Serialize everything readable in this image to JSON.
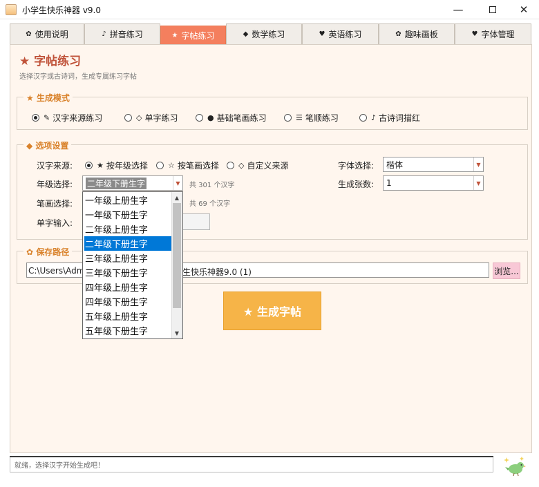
{
  "window": {
    "title": "小学生快乐神器 v9.0",
    "minimize_glyph": "—",
    "close_glyph": "✕"
  },
  "tabs": [
    {
      "icon": "✿",
      "label": "使用说明"
    },
    {
      "icon": "♪",
      "label": "拼音练习"
    },
    {
      "icon": "★",
      "label": "字帖练习",
      "active": true
    },
    {
      "icon": "◆",
      "label": "数学练习"
    },
    {
      "icon": "♥",
      "label": "英语练习"
    },
    {
      "icon": "✿",
      "label": "趣味画板"
    },
    {
      "icon": "♥",
      "label": "字体管理"
    }
  ],
  "page": {
    "title": "★ 字帖练习",
    "subtitle": "选择汉字或古诗词，生成专属练习字帖"
  },
  "mode": {
    "legend": "★ 生成模式",
    "options": [
      {
        "glyph": "✎",
        "label": "汉字来源练习",
        "checked": true
      },
      {
        "glyph": "◇",
        "label": "单字练习",
        "checked": false
      },
      {
        "glyph": "●",
        "label": "基础笔画练习",
        "checked": false
      },
      {
        "glyph": "☰",
        "label": "笔顺练习",
        "checked": false
      },
      {
        "glyph": "♪",
        "label": "古诗词描红",
        "checked": false
      }
    ]
  },
  "options": {
    "legend": "◆ 选项设置",
    "source_label": "汉字来源:",
    "source_options": [
      {
        "glyph": "★",
        "label": "按年级选择",
        "checked": true
      },
      {
        "glyph": "☆",
        "label": "按笔画选择",
        "checked": false
      },
      {
        "glyph": "◇",
        "label": "自定义来源",
        "checked": false
      }
    ],
    "grade_label": "年级选择:",
    "grade_value": "二年级下册生字",
    "grade_count": "共 301 个汉字",
    "stroke_label": "笔画选择:",
    "stroke_count": "共 69 个汉字",
    "char_label": "单字输入:",
    "font_label": "字体选择:",
    "font_value": "楷体",
    "pages_label": "生成张数:",
    "pages_value": "1"
  },
  "grade_dropdown": {
    "items": [
      "一年级上册生字",
      "一年级下册生字",
      "二年级上册生字",
      "二年级下册生字",
      "三年级上册生字",
      "三年级下册生字",
      "四年级上册生字",
      "四年级下册生字",
      "五年级上册生字",
      "五年级下册生字"
    ],
    "selected_index": 3
  },
  "save": {
    "legend": "✿ 保存路径",
    "path_visible_left": "C:\\Users\\Adm",
    "path_visible_right": "生快乐神器9.0 (1)",
    "browse_label": "浏览..."
  },
  "generate_label": "★ 生成字帖",
  "status_text": "就绪，选择汉字开始生成吧！",
  "colors": {
    "accent": "#f47f5e",
    "title": "#c0533a",
    "legend": "#d9822b",
    "generate_button": "#f6b448",
    "selection": "#0078d7",
    "page_bg": "#fff6ee"
  }
}
